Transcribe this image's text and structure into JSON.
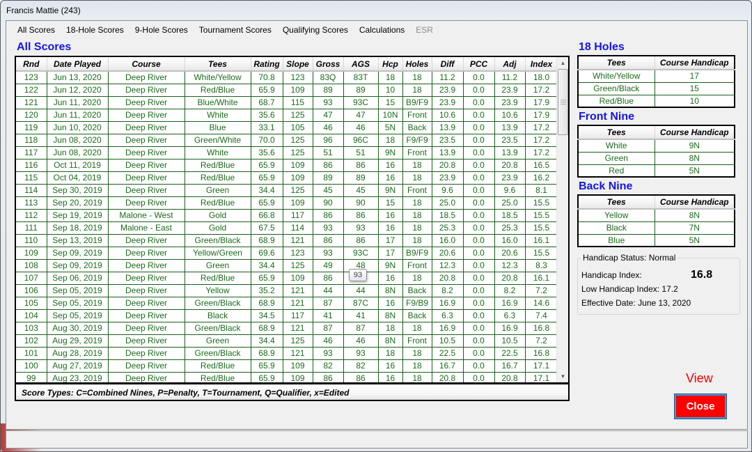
{
  "window": {
    "title": "Francis Mattie (243)"
  },
  "menu": [
    {
      "label": "All Scores",
      "enabled": true
    },
    {
      "label": "18-Hole Scores",
      "enabled": true
    },
    {
      "label": "9-Hole Scores",
      "enabled": true
    },
    {
      "label": "Tournament Scores",
      "enabled": true
    },
    {
      "label": "Qualifying Scores",
      "enabled": true
    },
    {
      "label": "Calculations",
      "enabled": true
    },
    {
      "label": "ESR",
      "enabled": false
    }
  ],
  "scores": {
    "title": "All Scores",
    "columns": [
      "Rnd",
      "Date Played",
      "Course",
      "Tees",
      "Rating",
      "Slope",
      "Gross",
      "AGS",
      "Hcp",
      "Holes",
      "Diff",
      "PCC",
      "Adj",
      "Index"
    ],
    "rows": [
      [
        "123",
        "Jun 13, 2020",
        "Deep River",
        "White/Yellow",
        "70.8",
        "123",
        "83Q",
        "83T",
        "18",
        "18",
        "11.2",
        "0.0",
        "11.2",
        "18.0"
      ],
      [
        "122",
        "Jun 12, 2020",
        "Deep River",
        "Red/Blue",
        "65.9",
        "109",
        "89",
        "89",
        "10",
        "18",
        "23.9",
        "0.0",
        "23.9",
        "17.2"
      ],
      [
        "121",
        "Jun 11, 2020",
        "Deep River",
        "Blue/White",
        "68.7",
        "115",
        "93",
        "93C",
        "15",
        "B9/F9",
        "23.9",
        "0.0",
        "23.9",
        "17.9"
      ],
      [
        "120",
        "Jun 11, 2020",
        "Deep River",
        "White",
        "35.6",
        "125",
        "47",
        "47",
        "10N",
        "Front",
        "10.6",
        "0.0",
        "10.6",
        "17.9"
      ],
      [
        "119",
        "Jun 10, 2020",
        "Deep River",
        "Blue",
        "33.1",
        "105",
        "46",
        "46",
        "5N",
        "Back",
        "13.9",
        "0.0",
        "13.9",
        "17.2"
      ],
      [
        "118",
        "Jun 08, 2020",
        "Deep River",
        "Green/White",
        "70.0",
        "125",
        "96",
        "96C",
        "18",
        "F9/F9",
        "23.5",
        "0.0",
        "23.5",
        "17.2"
      ],
      [
        "117",
        "Jun 08, 2020",
        "Deep River",
        "White",
        "35.6",
        "125",
        "51",
        "51",
        "9N",
        "Front",
        "13.9",
        "0.0",
        "13.9",
        "17.2"
      ],
      [
        "116",
        "Oct 11, 2019",
        "Deep River",
        "Red/Blue",
        "65.9",
        "109",
        "86",
        "86",
        "16",
        "18",
        "20.8",
        "0.0",
        "20.8",
        "16.5"
      ],
      [
        "115",
        "Oct 04, 2019",
        "Deep River",
        "Red/Blue",
        "65.9",
        "109",
        "89",
        "89",
        "16",
        "18",
        "23.9",
        "0.0",
        "23.9",
        "16.2"
      ],
      [
        "114",
        "Sep 30, 2019",
        "Deep River",
        "Green",
        "34.4",
        "125",
        "45",
        "45",
        "9N",
        "Front",
        "9.6",
        "0.0",
        "9.6",
        "8.1"
      ],
      [
        "113",
        "Sep 20, 2019",
        "Deep River",
        "Red/Blue",
        "65.9",
        "109",
        "90",
        "90",
        "15",
        "18",
        "25.0",
        "0.0",
        "25.0",
        "15.5"
      ],
      [
        "112",
        "Sep 19, 2019",
        "Malone - West",
        "Gold",
        "66.8",
        "117",
        "86",
        "86",
        "16",
        "18",
        "18.5",
        "0.0",
        "18.5",
        "15.5"
      ],
      [
        "111",
        "Sep 18, 2019",
        "Malone - East",
        "Gold",
        "67.5",
        "114",
        "93",
        "93",
        "16",
        "18",
        "25.3",
        "0.0",
        "25.3",
        "15.5"
      ],
      [
        "110",
        "Sep 13, 2019",
        "Deep River",
        "Green/Black",
        "68.9",
        "121",
        "86",
        "86",
        "17",
        "18",
        "16.0",
        "0.0",
        "16.0",
        "16.1"
      ],
      [
        "109",
        "Sep 09, 2019",
        "Deep River",
        "Yellow/Green",
        "69.6",
        "123",
        "93",
        "93C",
        "17",
        "B9/F9",
        "20.6",
        "0.0",
        "20.6",
        "15.5"
      ],
      [
        "108",
        "Sep 09, 2019",
        "Deep River",
        "Green",
        "34.4",
        "125",
        "49",
        "48",
        "9N",
        "Front",
        "12.3",
        "0.0",
        "12.3",
        "8.3"
      ],
      [
        "107",
        "Sep 06, 2019",
        "Deep River",
        "Red/Blue",
        "65.9",
        "109",
        "86",
        "86",
        "16",
        "18",
        "20.8",
        "0.0",
        "20.8",
        "16.1"
      ],
      [
        "106",
        "Sep 05, 2019",
        "Deep River",
        "Yellow",
        "35.2",
        "121",
        "44",
        "44",
        "8N",
        "Back",
        "8.2",
        "0.0",
        "8.2",
        "7.2"
      ],
      [
        "105",
        "Sep 05, 2019",
        "Deep River",
        "Green/Black",
        "68.9",
        "121",
        "87",
        "87C",
        "16",
        "F9/B9",
        "16.9",
        "0.0",
        "16.9",
        "14.6"
      ],
      [
        "104",
        "Sep 05, 2019",
        "Deep River",
        "Black",
        "34.5",
        "117",
        "41",
        "41",
        "8N",
        "Back",
        "6.3",
        "0.0",
        "6.3",
        "7.4"
      ],
      [
        "103",
        "Aug 30, 2019",
        "Deep River",
        "Green/Black",
        "68.9",
        "121",
        "87",
        "87",
        "18",
        "18",
        "16.9",
        "0.0",
        "16.9",
        "16.8"
      ],
      [
        "102",
        "Aug 29, 2019",
        "Deep River",
        "Green",
        "34.4",
        "125",
        "46",
        "46",
        "8N",
        "Front",
        "10.5",
        "0.0",
        "10.5",
        "7.2"
      ],
      [
        "101",
        "Aug 28, 2019",
        "Deep River",
        "Green/Black",
        "68.9",
        "121",
        "93",
        "93",
        "18",
        "18",
        "22.5",
        "0.0",
        "22.5",
        "16.8"
      ],
      [
        "100",
        "Aug 27, 2019",
        "Deep River",
        "Red/Blue",
        "65.9",
        "109",
        "82",
        "82",
        "16",
        "18",
        "16.7",
        "0.0",
        "16.7",
        "17.1"
      ],
      [
        "99",
        "Aug 23, 2019",
        "Deep River",
        "Red/Blue",
        "65.9",
        "109",
        "86",
        "86",
        "16",
        "18",
        "20.8",
        "0.0",
        "20.8",
        "17.1"
      ]
    ],
    "tooltip": "93",
    "legend": "Score Types: C=Combined Nines, P=Penalty, T=Tournament, Q=Qualifier, x=Edited"
  },
  "course_handicaps": [
    {
      "title": "18 Holes",
      "columns": [
        "Tees",
        "Course Handicap"
      ],
      "rows": [
        [
          "White/Yellow",
          "17"
        ],
        [
          "Green/Black",
          "15"
        ],
        [
          "Red/Blue",
          "10"
        ]
      ]
    },
    {
      "title": "Front Nine",
      "columns": [
        "Tees",
        "Course Handicap"
      ],
      "rows": [
        [
          "White",
          "9N"
        ],
        [
          "Green",
          "8N"
        ],
        [
          "Red",
          "5N"
        ]
      ]
    },
    {
      "title": "Back Nine",
      "columns": [
        "Tees",
        "Course Handicap"
      ],
      "rows": [
        [
          "Yellow",
          "8N"
        ],
        [
          "Black",
          "7N"
        ],
        [
          "Blue",
          "5N"
        ]
      ]
    }
  ],
  "handicap_status": {
    "legend": "Handicap Status: Normal",
    "index_label": "Handicap Index:",
    "index_value": "16.8",
    "low_index": "Low Handicap Index: 17.2",
    "effective_date": "Effective Date: June 13, 2020"
  },
  "actions": {
    "view_label": "View",
    "close_label": "Close"
  },
  "colors": {
    "section_title": "#1515e6",
    "cell_text": "#1c6a1c",
    "grid_line": "#1a5e1a",
    "close_bg": "#ff0000",
    "view_text": "#f00000"
  }
}
